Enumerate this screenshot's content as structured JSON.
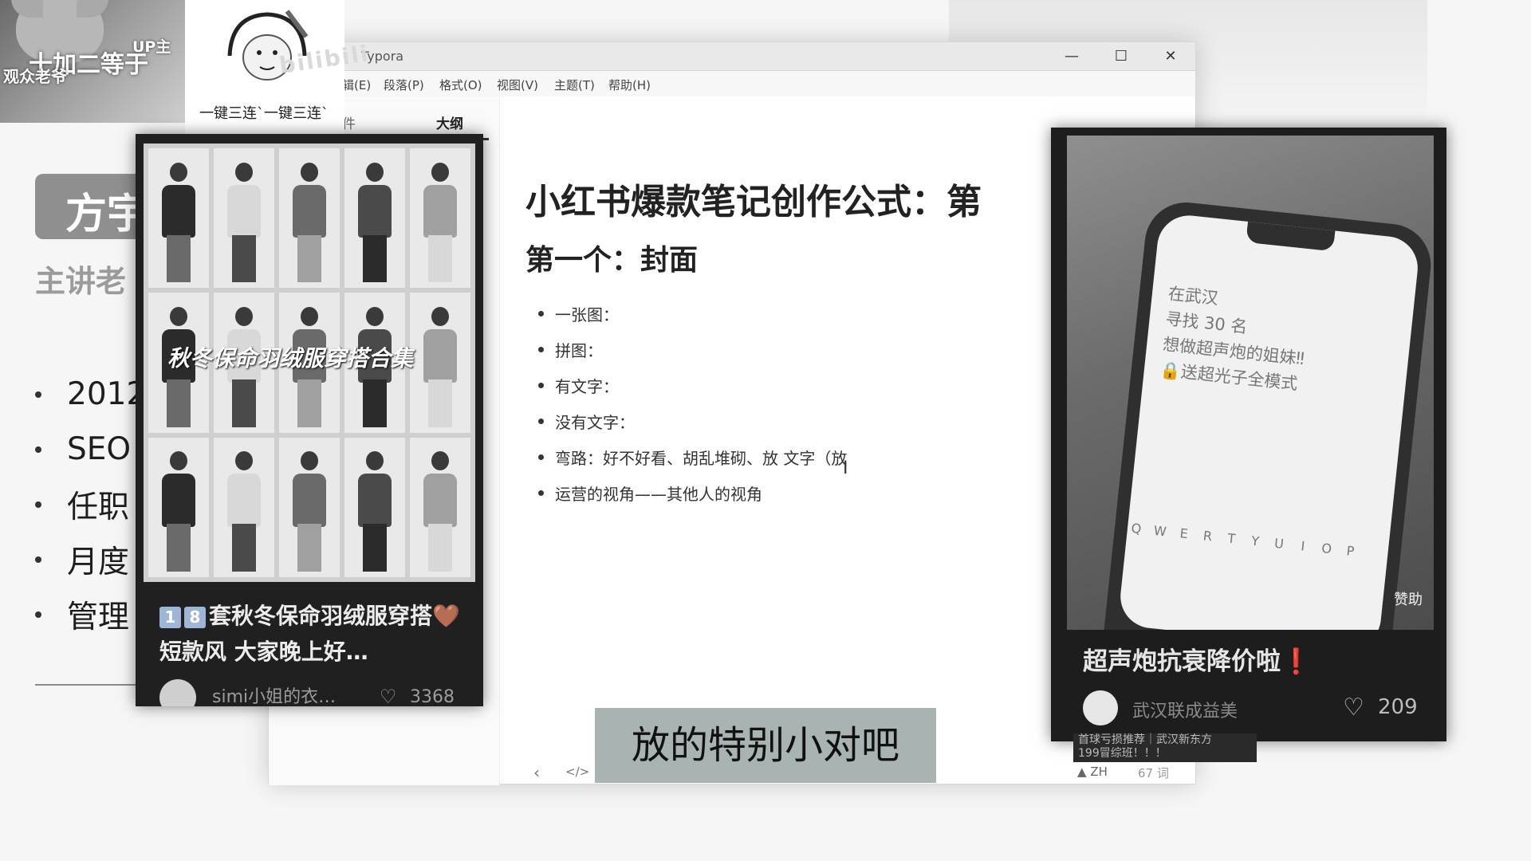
{
  "slide": {
    "title": "方宇",
    "subtitle": "主讲老",
    "bullets": [
      "2012",
      "SEO",
      "任职",
      "月度",
      "管理"
    ]
  },
  "uploader": {
    "title": "十加二等于",
    "owner_tag": "UP主",
    "viewers": "观众老爷",
    "sticker_caption": "一键三连`一键三连`",
    "watermark": "bilibili"
  },
  "typora": {
    "window_title": "Typora",
    "window_controls": {
      "minimize": "—",
      "maximize": "☐",
      "close": "✕"
    },
    "menu": [
      "辑(E)",
      "段落(P)",
      "格式(O)",
      "视图(V)",
      "主题(T)",
      "帮助(H)"
    ],
    "sidebar_tab_file": "件",
    "sidebar_tab_outline": "大纲",
    "document": {
      "h1": "小红书爆款笔记创作公式：第",
      "h2": "第一个：封面",
      "items": [
        "一张图：",
        "拼图：",
        "有文字：",
        "没有文字：",
        "弯路：好不好看、胡乱堆砌、放 文字（放",
        "运营的视角——其他人的视角"
      ]
    },
    "status": {
      "back": "‹",
      "source_mode": "</>",
      "lang": "▲ ZH",
      "word_count": "67 词"
    }
  },
  "card_left": {
    "overlay_text": "秋冬保命羽绒服穿搭合集",
    "badge_1": "1",
    "badge_2": "8",
    "title": "套秋冬保命羽绒服穿搭🤎短款风 大家晚上好…",
    "author": "simi小姐的衣…",
    "likes": "3368",
    "photo_colors": [
      "#2b2b2b",
      "#d8d8d8",
      "#6a6a6a",
      "#4a4a4a",
      "#a0a0a0"
    ]
  },
  "card_right": {
    "phone_lines": [
      "在武汉",
      "寻找 30 名",
      "想做超声炮的姐妹‼",
      "🔒送超光子全模式"
    ],
    "keyboard_row": [
      "Q",
      "W",
      "E",
      "R",
      "T",
      "Y",
      "U",
      "I",
      "O",
      "P"
    ],
    "appreciate": "赞助",
    "title": "超声炮抗衰降价啦❗",
    "author": "武汉联成益美",
    "likes": "209"
  },
  "peek_card": {
    "line1": "首球亏损推荐｜武汉新东方",
    "line2": "199冒综班！！！"
  },
  "subtitle": "放的特别小对吧"
}
